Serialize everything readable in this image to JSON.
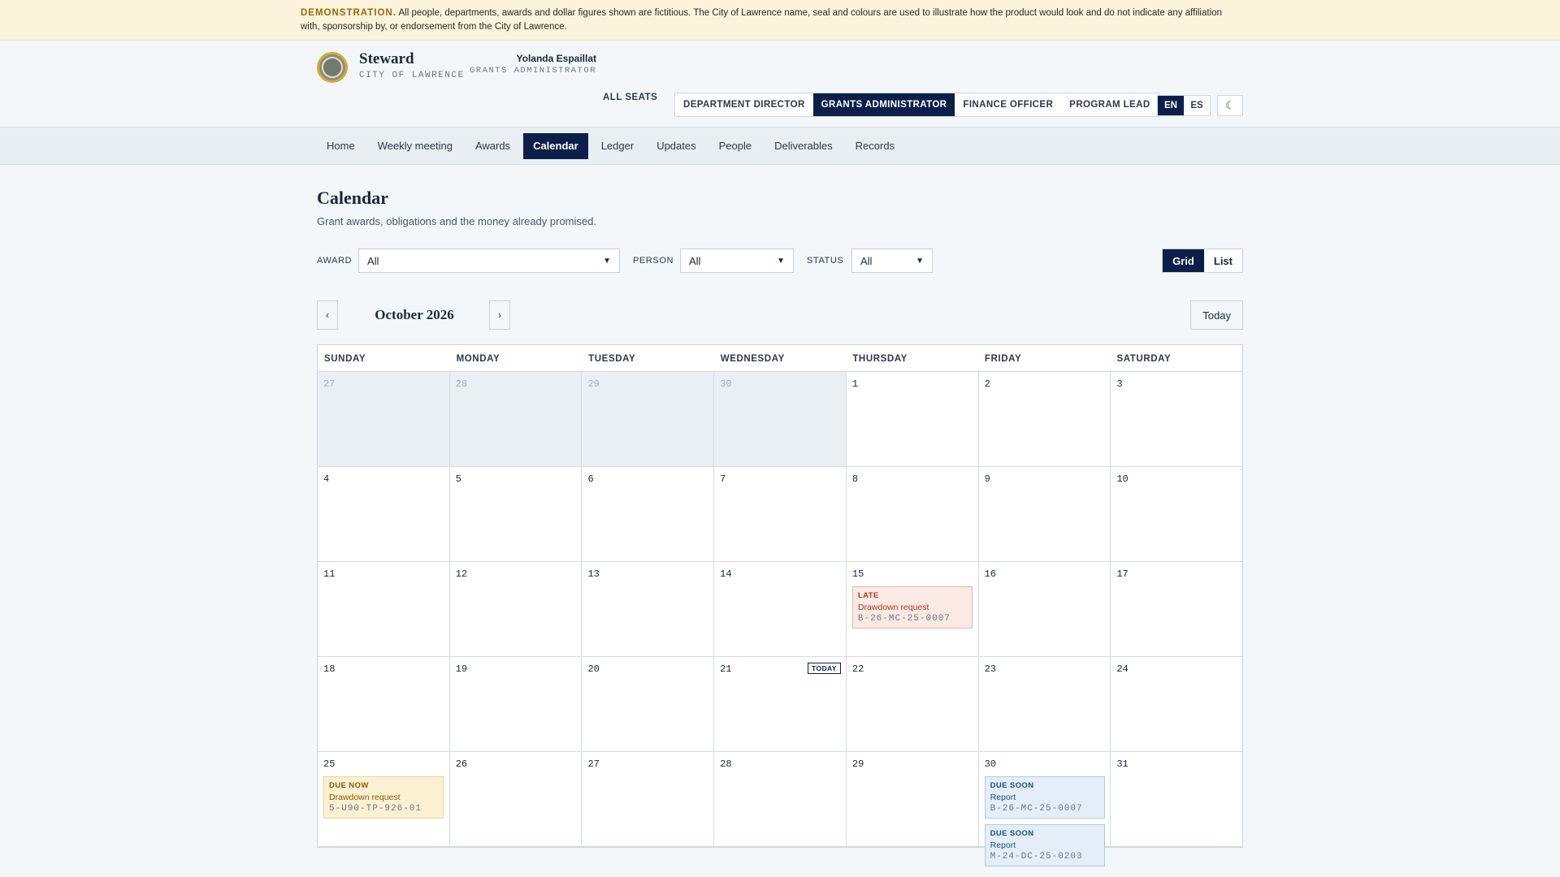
{
  "banner": {
    "lead": "DEMONSTRATION.",
    "text": "All people, departments, awards and dollar figures shown are fictitious. The City of Lawrence name, seal and colours are used to illustrate how the product would look and do not indicate any affiliation with, sponsorship by, or endorsement from the City of Lawrence."
  },
  "brand": {
    "name": "Steward",
    "sub": "CITY OF LAWRENCE"
  },
  "user": {
    "name": "Yolanda Espaillat",
    "role": "GRANTS ADMINISTRATOR"
  },
  "seats": {
    "all_label": "ALL SEATS",
    "tabs": [
      "DEPARTMENT DIRECTOR",
      "GRANTS ADMINISTRATOR",
      "FINANCE OFFICER",
      "PROGRAM LEAD"
    ],
    "active": "GRANTS ADMINISTRATOR"
  },
  "lang": {
    "en": "EN",
    "es": "ES",
    "active": "EN"
  },
  "theme_icon": "moon-icon",
  "nav": {
    "items": [
      "Home",
      "Weekly meeting",
      "Awards",
      "Calendar",
      "Ledger",
      "Updates",
      "People",
      "Deliverables",
      "Records"
    ],
    "active": "Calendar"
  },
  "page": {
    "title": "Calendar",
    "subtitle": "Grant awards, obligations and the money already promised."
  },
  "filters": {
    "award_label": "AWARD",
    "award_value": "All",
    "person_label": "PERSON",
    "person_value": "All",
    "status_label": "STATUS",
    "status_value": "All"
  },
  "view": {
    "grid": "Grid",
    "list": "List",
    "active": "Grid"
  },
  "month": {
    "prev": "‹",
    "next": "›",
    "title": "October 2026",
    "today": "Today"
  },
  "calendar": {
    "weekdays": [
      "SUNDAY",
      "MONDAY",
      "TUESDAY",
      "WEDNESDAY",
      "THURSDAY",
      "FRIDAY",
      "SATURDAY"
    ],
    "today_badge": "TODAY",
    "weeks": [
      [
        {
          "n": "27",
          "other": true
        },
        {
          "n": "28",
          "other": true
        },
        {
          "n": "29",
          "other": true
        },
        {
          "n": "30",
          "other": true
        },
        {
          "n": "1"
        },
        {
          "n": "2"
        },
        {
          "n": "3"
        }
      ],
      [
        {
          "n": "4"
        },
        {
          "n": "5"
        },
        {
          "n": "6"
        },
        {
          "n": "7"
        },
        {
          "n": "8"
        },
        {
          "n": "9"
        },
        {
          "n": "10"
        }
      ],
      [
        {
          "n": "11"
        },
        {
          "n": "12"
        },
        {
          "n": "13"
        },
        {
          "n": "14"
        },
        {
          "n": "15",
          "events": [
            {
              "kind": "late",
              "status": "LATE",
              "title": "Drawdown request",
              "code": "B-26-MC-25-0007"
            }
          ]
        },
        {
          "n": "16"
        },
        {
          "n": "17"
        }
      ],
      [
        {
          "n": "18"
        },
        {
          "n": "19"
        },
        {
          "n": "20"
        },
        {
          "n": "21",
          "today": true
        },
        {
          "n": "22"
        },
        {
          "n": "23"
        },
        {
          "n": "24"
        }
      ],
      [
        {
          "n": "25",
          "events": [
            {
              "kind": "now",
              "status": "DUE NOW",
              "title": "Drawdown request",
              "code": "5-U90-TP-926-01"
            }
          ]
        },
        {
          "n": "26"
        },
        {
          "n": "27"
        },
        {
          "n": "28"
        },
        {
          "n": "29"
        },
        {
          "n": "30",
          "events": [
            {
              "kind": "soon",
              "status": "DUE SOON",
              "title": "Report",
              "code": "B-26-MC-25-0007"
            },
            {
              "kind": "soon",
              "status": "DUE SOON",
              "title": "Report",
              "code": "M-24-DC-25-0203"
            }
          ]
        },
        {
          "n": "31"
        }
      ]
    ]
  }
}
